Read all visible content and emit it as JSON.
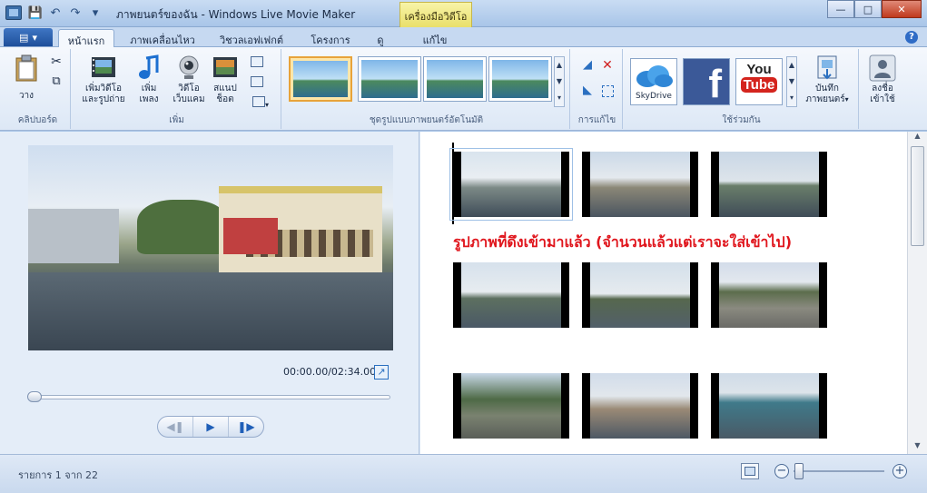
{
  "window": {
    "title": "ภาพยนตร์ของฉัน - Windows Live Movie Maker",
    "context_tab_group": "เครื่องมือวิดีโอ"
  },
  "tabs": [
    {
      "label": "หน้าแรก",
      "active": true
    },
    {
      "label": "ภาพเคลื่อนไหว",
      "active": false
    },
    {
      "label": "วิชวลเอฟเฟกต์",
      "active": false
    },
    {
      "label": "โครงการ",
      "active": false
    },
    {
      "label": "ดู",
      "active": false
    },
    {
      "label": "แก้ไข",
      "active": false
    }
  ],
  "ribbon": {
    "clipboard": {
      "group_label": "คลิปบอร์ด",
      "paste_label": "วาง"
    },
    "add": {
      "group_label": "เพิ่ม",
      "add_video_label_1": "เพิ่มวิดีโอ",
      "add_video_label_2": "และรูปถ่าย",
      "add_music_label_1": "เพิ่ม",
      "add_music_label_2": "เพลง",
      "webcam_label_1": "วิดีโอ",
      "webcam_label_2": "เว็บแคม",
      "snapshot_label_1": "สแนป",
      "snapshot_label_2": "ช็อต"
    },
    "themes": {
      "group_label": "ชุดรูปแบบภาพยนตร์อัตโนมัติ"
    },
    "editing": {
      "group_label": "การแก้ไข"
    },
    "share": {
      "group_label": "ใช้ร่วมกัน",
      "skydrive_label": "SkyDrive",
      "youtube_label_1": "You",
      "youtube_label_2": "Tube",
      "save_movie_label_1": "บันทึก",
      "save_movie_label_2": "ภาพยนตร์"
    },
    "signin": {
      "label_1": "ลงชื่อ",
      "label_2": "เข้าใช้"
    }
  },
  "preview": {
    "timecode": "00:00.00/02:34.00",
    "seek_fraction": 0.0
  },
  "storyboard": {
    "overlay_note": "รูปภาพที่ดึงเข้ามาแล้ว (จำนวนแล้วแต่เราจะใส่เข้าไป)",
    "item_count_visible": 9
  },
  "status": {
    "item_text": "รายการ 1 จาก 22"
  },
  "colors": {
    "accent": "#1f5fb8",
    "note_red": "#e0161d",
    "context_yellow": "#e9df6a",
    "youtube_red": "#d4241d",
    "facebook_blue": "#3b5998"
  }
}
